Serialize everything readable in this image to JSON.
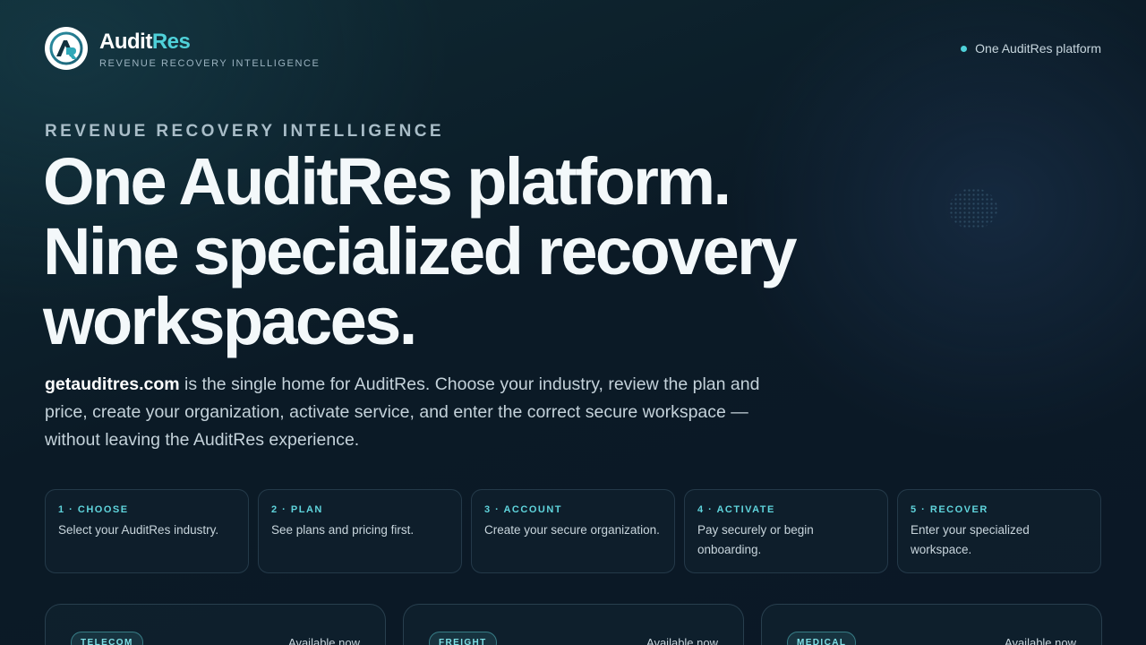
{
  "brand": {
    "name_main": "Audit",
    "name_accent": "Res",
    "tagline": "REVENUE RECOVERY INTELLIGENCE",
    "logo_icon": "auditres-logo-icon",
    "accent_color": "#4fd1d9"
  },
  "header": {
    "status_text": "One AuditRes platform"
  },
  "hero": {
    "eyebrow": "REVENUE RECOVERY INTELLIGENCE",
    "headline_lines": [
      "One AuditRes platform.",
      "Nine specialized recovery",
      "workspaces."
    ],
    "intro_domain": "getauditres.com",
    "intro_text": " is the single home for AuditRes. Choose your industry, review the plan and price, create your organization, activate service, and enter the correct secure workspace — without leaving the AuditRes experience."
  },
  "steps": [
    {
      "title": "1 · CHOOSE",
      "desc": "Select your AuditRes industry."
    },
    {
      "title": "2 · PLAN",
      "desc": "See plans and pricing first."
    },
    {
      "title": "3 · ACCOUNT",
      "desc": "Create your secure organization."
    },
    {
      "title": "4 · ACTIVATE",
      "desc": "Pay securely or begin onboarding."
    },
    {
      "title": "5 · RECOVER",
      "desc": "Enter your specialized workspace."
    }
  ],
  "cards": [
    {
      "tag": "TELECOM",
      "status": "Available now"
    },
    {
      "tag": "FREIGHT",
      "status": "Available now"
    },
    {
      "tag": "MEDICAL",
      "status": "Available now"
    }
  ]
}
